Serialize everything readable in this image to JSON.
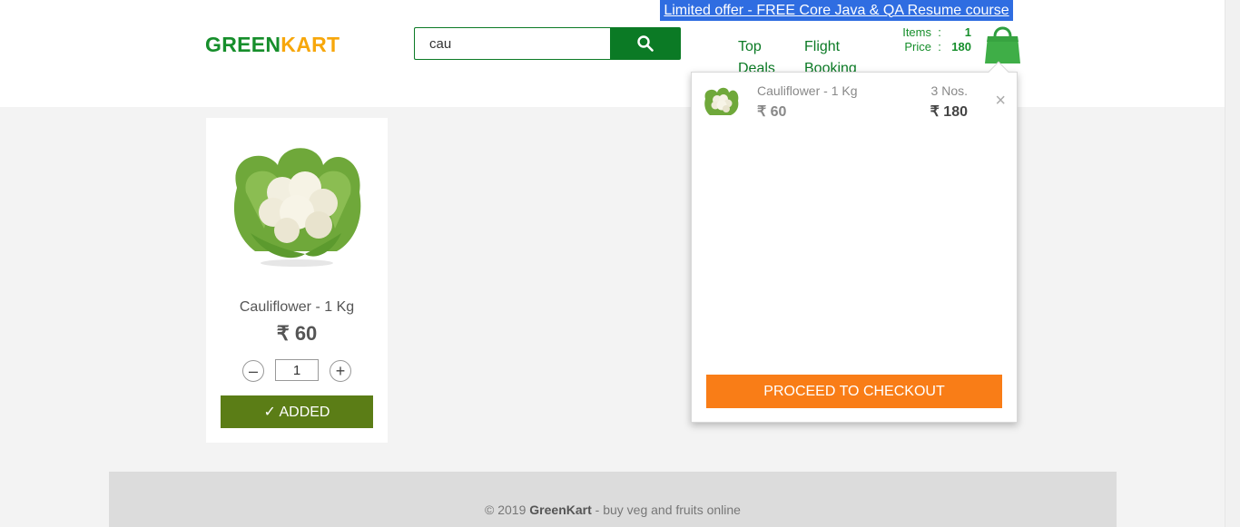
{
  "header": {
    "logo_green": "GREEN",
    "logo_kart": "KART",
    "search_value": "cau",
    "promo_text": "Limited offer - FREE Core Java & QA Resume course",
    "nav": [
      {
        "label": "Top Deals"
      },
      {
        "label": "Flight Booking"
      }
    ],
    "cart_info": {
      "items_label": "Items",
      "items_value": "1",
      "price_label": "Price",
      "price_value": "180",
      "colon": ":"
    },
    "icons": {
      "search": "search-icon",
      "cart": "shopping-bag-icon"
    }
  },
  "product": {
    "name": "Cauliflower - 1 Kg",
    "price": "₹ 60",
    "quantity": "1",
    "decrement": "–",
    "increment": "+",
    "added_label": "✓ ADDED"
  },
  "cart_preview": {
    "item_name": "Cauliflower - 1 Kg",
    "item_price": "₹ 60",
    "item_qty": "3 Nos.",
    "item_amount": "₹ 180",
    "remove": "×",
    "checkout_label": "PROCEED TO CHECKOUT"
  },
  "footer": {
    "copyright": "© 2019 ",
    "brand": "GreenKart",
    "tagline": " - buy veg and fruits online"
  },
  "colors": {
    "brand_green": "#168e2b",
    "brand_orange": "#f7a70b",
    "added_green": "#5b7d16",
    "checkout_orange": "#f97d17",
    "promo_blue": "#2f6de1"
  }
}
